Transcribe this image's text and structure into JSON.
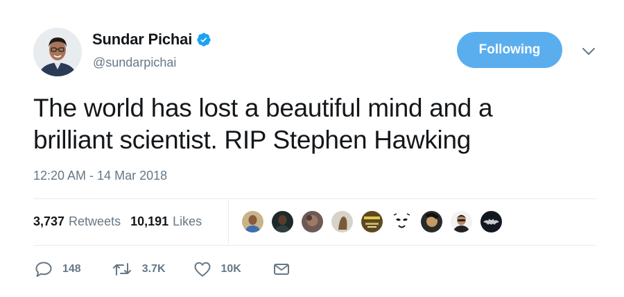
{
  "author": {
    "name": "Sundar Pichai",
    "handle": "@sundarpichai",
    "verified": true
  },
  "follow_button": {
    "label": "Following",
    "color": "#5aaeee"
  },
  "tweet": {
    "line1": "The world has lost a beautiful mind and a",
    "line2": "brilliant scientist. RIP Stephen Hawking"
  },
  "timestamp": "12:20 AM - 14 Mar 2018",
  "stats": {
    "retweets_count": "3,737",
    "retweets_label": "Retweets",
    "likes_count": "10,191",
    "likes_label": "Likes"
  },
  "likers": [
    {
      "icon": "liker-avatar-1"
    },
    {
      "icon": "liker-avatar-2"
    },
    {
      "icon": "liker-avatar-3"
    },
    {
      "icon": "liker-avatar-4"
    },
    {
      "icon": "liker-avatar-5"
    },
    {
      "icon": "liker-avatar-6"
    },
    {
      "icon": "liker-avatar-7"
    },
    {
      "icon": "liker-avatar-8"
    },
    {
      "icon": "liker-avatar-9"
    }
  ],
  "actions": {
    "reply_count": "148",
    "retweet_count": "3.7K",
    "like_count": "10K"
  },
  "colors": {
    "text": "#14171a",
    "secondary": "#657786",
    "verified": "#1da1f2",
    "divider": "#e6ecf0"
  }
}
